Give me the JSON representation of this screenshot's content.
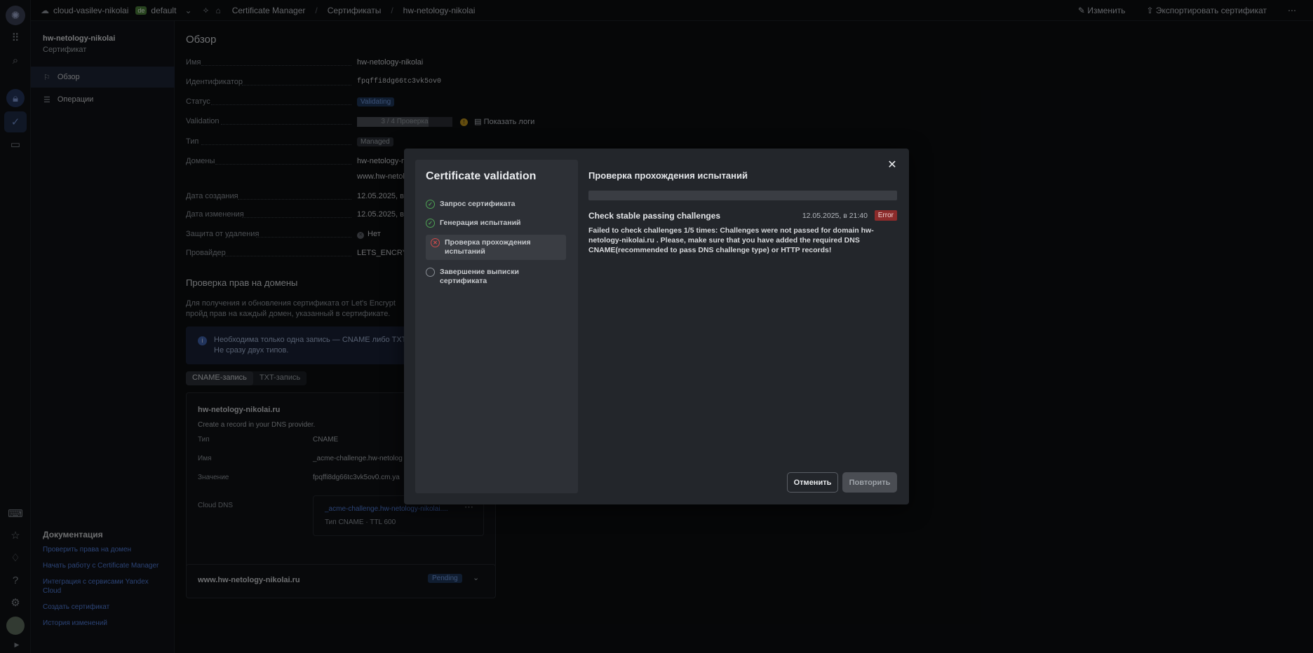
{
  "topbar": {
    "cloud": "cloud-vasilev-nikolai",
    "folder_badge": "de",
    "folder": "default",
    "service": "Certificate Manager",
    "section": "Сертификаты",
    "current": "hw-netology-nikolai",
    "edit": "Изменить",
    "export": "Экспортировать сертификат",
    "more": "⋯"
  },
  "sidebar": {
    "title": "hw-netology-nikolai",
    "subtitle": "Сертификат",
    "items": [
      {
        "label": "Обзор",
        "active": true
      },
      {
        "label": "Операции",
        "active": false
      }
    ],
    "docs_title": "Документация",
    "docs_links": [
      "Проверить права на домен",
      "Начать работу с Certificate Manager",
      "Интеграция с сервисами Yandex Cloud",
      "Создать сертификат",
      "История изменений"
    ]
  },
  "overview": {
    "title": "Обзор",
    "name_label": "Имя",
    "name_value": "hw-netology-nikolai",
    "id_label": "Идентификатор",
    "id_value": "fpqffi8dg66tc3vk5ov0",
    "status_label": "Статус",
    "status_value": "Validating",
    "validation_label": "Validation",
    "validation_value": "3 / 4 Проверка",
    "validation_progress": 0.75,
    "show_logs": "Показать логи",
    "type_label": "Тип",
    "type_value": "Managed",
    "domains_label": "Домены",
    "domain1": "hw-netology-n",
    "domain2": "www.hw-netol",
    "created_label": "Дата создания",
    "created_value": "12.05.2025, в",
    "modified_label": "Дата изменения",
    "modified_value": "12.05.2025, в",
    "protect_label": "Защита от удаления",
    "protect_value": "Нет",
    "provider_label": "Провайдер",
    "provider_value": "LETS_ENCRYP"
  },
  "rights": {
    "title": "Проверка прав на домены",
    "para": "Для получения и обновления сертификата от Let's Encrypt пройд прав на каждый домен, указанный в сертификате.",
    "info": "Необходима только одна запись — CNAME либо TXT. Не сразу двух типов.",
    "tab_cname": "CNAME-запись",
    "tab_txt": "TXT-запись",
    "card_domain": "hw-netology-nikolai.ru",
    "card_sub": "Create a record in your DNS provider.",
    "type_k": "Тип",
    "type_v": "CNAME",
    "name_k": "Имя",
    "name_v": "_acme-challenge.hw-netolog",
    "value_k": "Значение",
    "value_v": "fpqffi8dg66tc3vk5ov0.cm.ya",
    "clouddns_k": "Cloud DNS",
    "dns_link": "_acme-challenge.hw-netology-nikolai....",
    "dns_meta": "Тип CNAME · TTL 600",
    "www_domain": "www.hw-netology-nikolai.ru",
    "www_status": "Pending"
  },
  "modal": {
    "title": "Certificate validation",
    "steps": [
      {
        "label": "Запрос сертификата",
        "state": "done"
      },
      {
        "label": "Генерация испытаний",
        "state": "done"
      },
      {
        "label": "Проверка прохождения испытаний",
        "state": "error"
      },
      {
        "label": "Завершение выписки сертификата",
        "state": "pending"
      }
    ],
    "right_title": "Проверка прохождения испытаний",
    "check_title": "Check stable passing challenges",
    "check_date": "12.05.2025, в 21:40",
    "check_status": "Error",
    "message": "Failed to check challenges 1/5 times: Challenges were not passed for domain hw-netology-nikolai.ru . Please, make sure that you have added the required DNS CNAME(recommended to pass DNS challenge type) or HTTP records!",
    "cancel": "Отменить",
    "retry": "Повторить",
    "close": "✕"
  }
}
